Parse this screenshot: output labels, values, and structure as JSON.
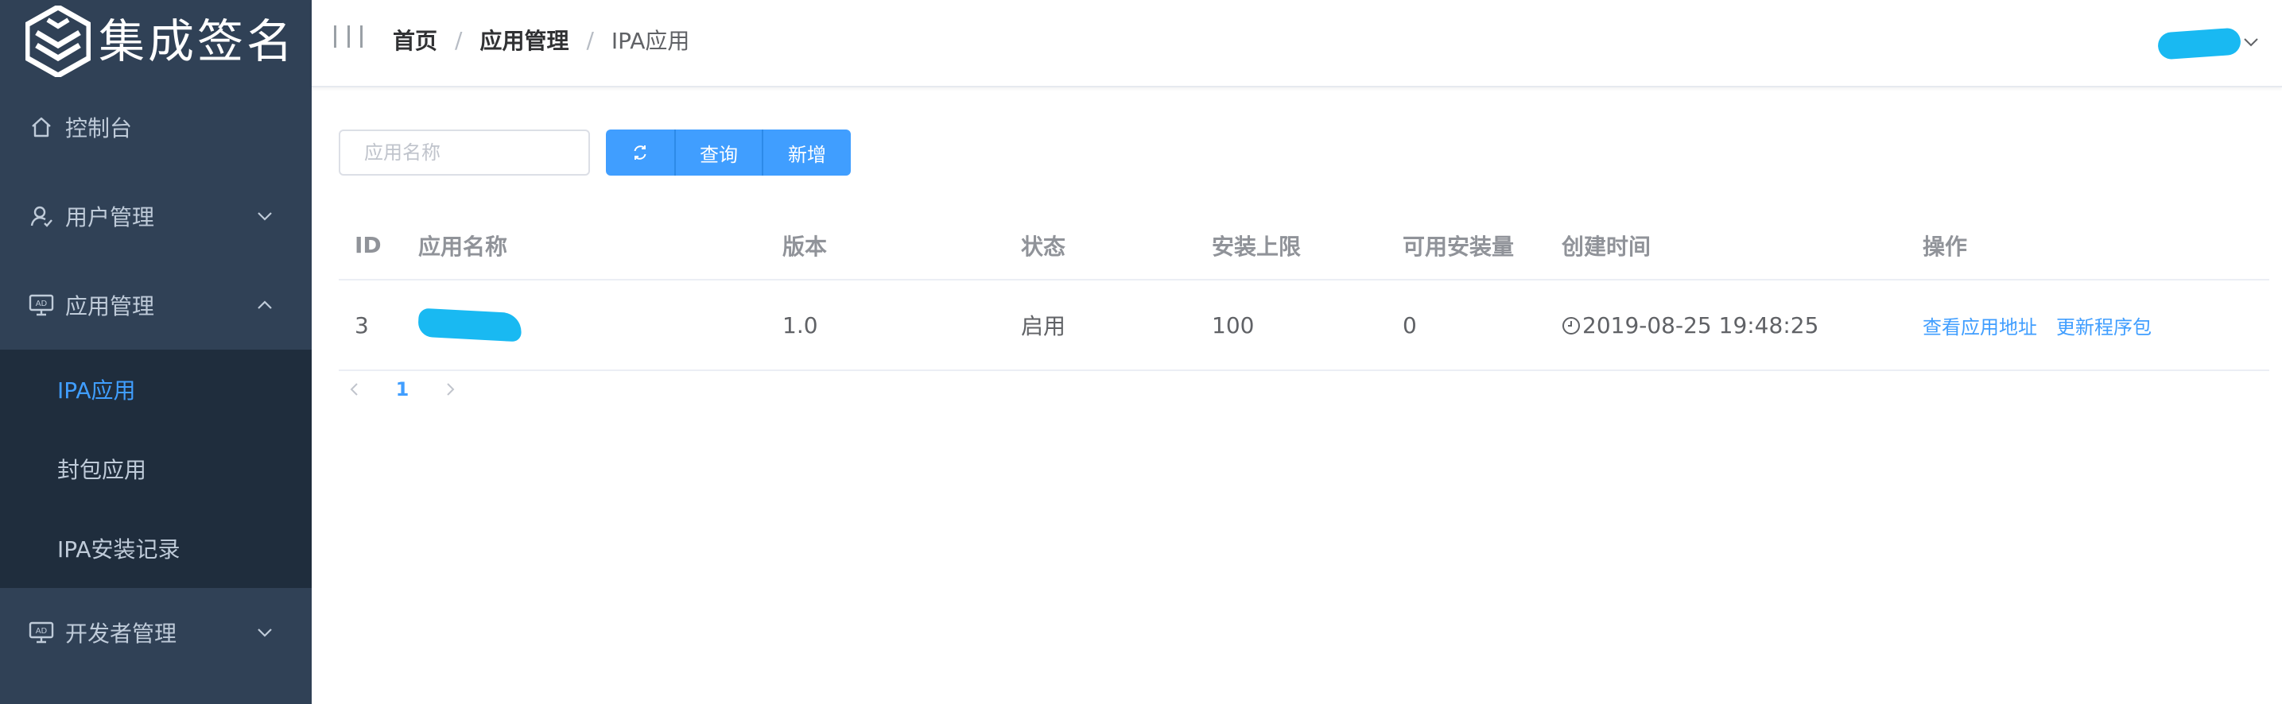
{
  "brand": {
    "name": "集成签名"
  },
  "sidebar": {
    "items": [
      {
        "label": "控制台",
        "icon": "home-icon"
      },
      {
        "label": "用户管理",
        "icon": "user-icon",
        "expanded": false
      },
      {
        "label": "应用管理",
        "icon": "ad-icon",
        "expanded": true,
        "children": [
          {
            "label": "IPA应用",
            "active": true
          },
          {
            "label": "封包应用",
            "active": false
          },
          {
            "label": "IPA安装记录",
            "active": false
          }
        ]
      },
      {
        "label": "开发者管理",
        "icon": "ad-icon",
        "expanded": false
      }
    ]
  },
  "header": {
    "breadcrumb": [
      "首页",
      "应用管理",
      "IPA应用"
    ],
    "separator": "/"
  },
  "toolbar": {
    "search_placeholder": "应用名称",
    "query_label": "查询",
    "add_label": "新增"
  },
  "table": {
    "columns": [
      "ID",
      "应用名称",
      "版本",
      "状态",
      "安装上限",
      "可用安装量",
      "创建时间",
      "操作"
    ],
    "rows": [
      {
        "id": "3",
        "name": "",
        "version": "1.0",
        "status": "启用",
        "install_limit": "100",
        "available": "0",
        "created": "2019-08-25 19:48:25",
        "actions": [
          "查看应用地址",
          "更新程序包"
        ]
      }
    ]
  },
  "pagination": {
    "current": "1"
  },
  "colors": {
    "sidebar_bg": "#304156",
    "submenu_bg": "#1f2d3d",
    "accent": "#409eff",
    "redaction": "#19b9f2"
  }
}
